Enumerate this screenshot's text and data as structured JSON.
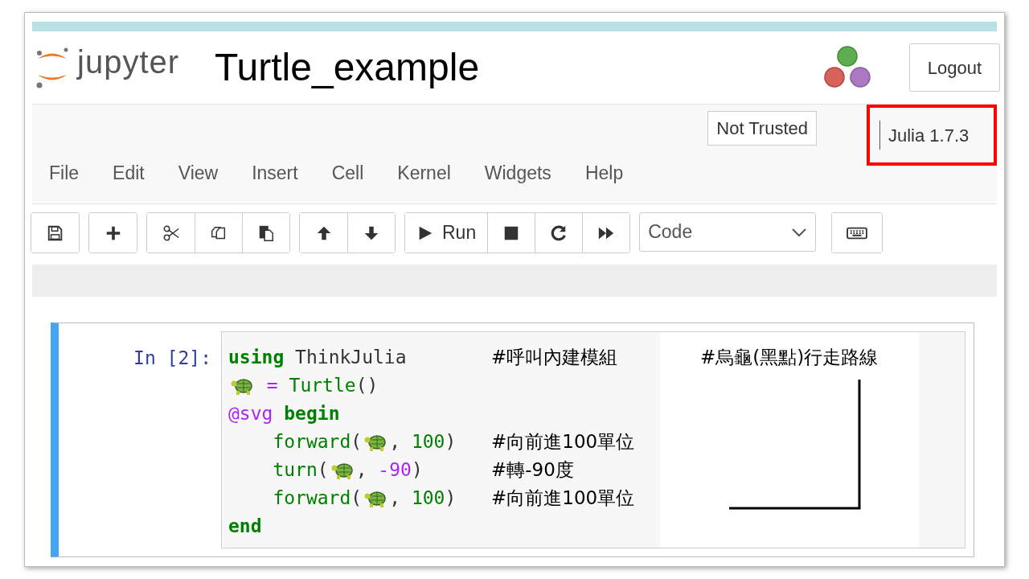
{
  "header": {
    "logo_text": "jupyter",
    "notebook_title": "Turtle_example",
    "logout_button": "Logout"
  },
  "notification_area": {
    "trust_indicator": "Not Trusted",
    "kernel_indicator": {
      "label": "Julia 1.7.3",
      "highlighted": true
    }
  },
  "menu": [
    "File",
    "Edit",
    "View",
    "Insert",
    "Cell",
    "Kernel",
    "Widgets",
    "Help"
  ],
  "toolbar": {
    "groups": [
      [
        {
          "kind": "save"
        }
      ],
      [
        {
          "kind": "insert"
        }
      ],
      [
        {
          "kind": "cut"
        },
        {
          "kind": "copy"
        },
        {
          "kind": "paste"
        }
      ],
      [
        {
          "kind": "move-up"
        },
        {
          "kind": "move-down"
        }
      ],
      [
        {
          "kind": "run",
          "label": "Run"
        },
        {
          "kind": "interrupt"
        },
        {
          "kind": "restart"
        },
        {
          "kind": "run-all"
        }
      ],
      [
        {
          "kind": "cell-type",
          "value": "Code"
        }
      ],
      [
        {
          "kind": "keyboard"
        }
      ]
    ]
  },
  "cell": {
    "prompt": "In [2]:",
    "lines": [
      {
        "tokens": [
          {
            "kind": "keyword",
            "text": "using"
          },
          {
            "kind": "plain",
            "text": " ThinkJulia"
          }
        ],
        "comment": "#呼叫內建模組"
      },
      {
        "tokens": [
          {
            "kind": "turtle"
          },
          {
            "kind": "operator",
            "text": " = "
          },
          {
            "kind": "builtin",
            "text": "Turtle"
          },
          {
            "kind": "plain",
            "text": "()"
          }
        ]
      },
      {
        "tokens": [
          {
            "kind": "macro",
            "text": "@svg"
          },
          {
            "kind": "keyword",
            "text": " begin"
          }
        ],
        "children": [
          {
            "tokens": [
              {
                "kind": "builtin",
                "text": "forward"
              },
              {
                "kind": "plain",
                "text": "("
              },
              {
                "kind": "turtle"
              },
              {
                "kind": "plain",
                "text": ", "
              },
              {
                "kind": "number",
                "text": "100"
              },
              {
                "kind": "plain",
                "text": ")"
              }
            ],
            "comment": "#向前進100單位"
          },
          {
            "tokens": [
              {
                "kind": "builtin",
                "text": "turn"
              },
              {
                "kind": "plain",
                "text": "("
              },
              {
                "kind": "turtle"
              },
              {
                "kind": "plain",
                "text": ", "
              },
              {
                "kind": "operator",
                "text": "-90"
              },
              {
                "kind": "plain",
                "text": ")"
              }
            ],
            "comment": "#轉-90度"
          },
          {
            "tokens": [
              {
                "kind": "builtin",
                "text": "forward"
              },
              {
                "kind": "plain",
                "text": "("
              },
              {
                "kind": "turtle"
              },
              {
                "kind": "plain",
                "text": ", "
              },
              {
                "kind": "number",
                "text": "100"
              },
              {
                "kind": "plain",
                "text": ")"
              }
            ],
            "comment": "#向前進100單位"
          }
        ]
      },
      {
        "tokens": [
          {
            "kind": "keyword",
            "text": "end"
          }
        ]
      }
    ]
  },
  "output": {
    "annotation": "#烏龜(黑點)行走路線"
  }
}
